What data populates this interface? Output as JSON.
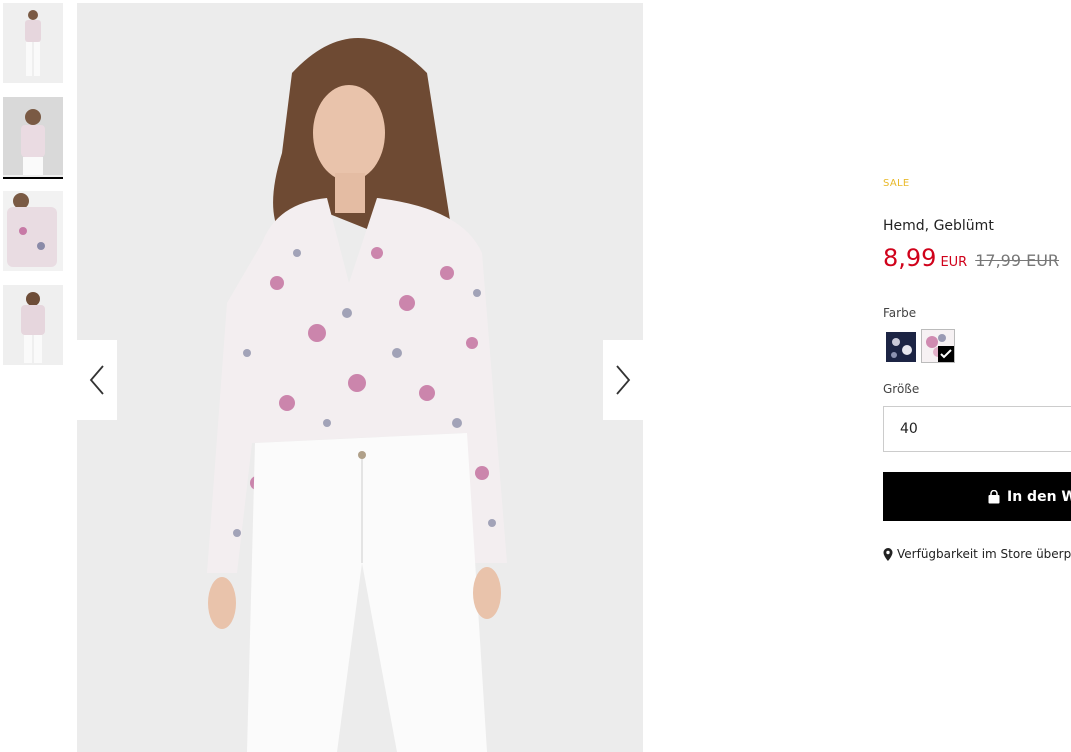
{
  "gallery": {
    "thumbnails": [
      {
        "label": "Vorderansicht ganz"
      },
      {
        "label": "Vorderansicht"
      },
      {
        "label": "Detail"
      },
      {
        "label": "Rückansicht"
      }
    ],
    "active_index": 1,
    "prev_icon": "chevron-left-icon",
    "next_icon": "chevron-right-icon"
  },
  "product": {
    "badge": "SALE",
    "name": "Hemd, Geblümt",
    "price_new": "8,99",
    "currency_new": "EUR",
    "price_old": "17,99 EUR",
    "color_label": "Farbe",
    "colors": [
      {
        "name": "navy floral",
        "hex": "#1c2444",
        "selected": false
      },
      {
        "name": "ecru floral",
        "hex": "#f4f0f2",
        "selected": true
      }
    ],
    "size_label": "Größe",
    "size_value": "40",
    "cart_button": "In den W",
    "store_link": "Verfügbarkeit im Store überp"
  },
  "colors": {
    "sale": "#e8b92a",
    "price": "#d0021b",
    "button": "#000000"
  }
}
